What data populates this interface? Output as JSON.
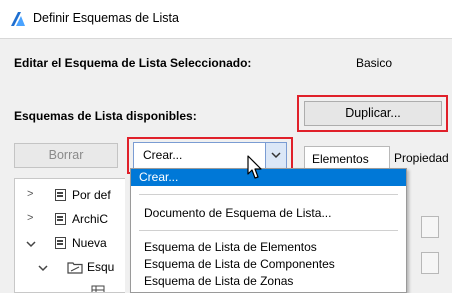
{
  "window": {
    "title": "Definir Esquemas de Lista"
  },
  "header": {
    "edit_label": "Editar el Esquema de Lista Seleccionado:",
    "edit_value": "Basico"
  },
  "schemes": {
    "available_label": "Esquemas de Lista disponibles:",
    "duplicate_button": "Duplicar...",
    "delete_button": "Borrar"
  },
  "combo": {
    "selected": "Crear..."
  },
  "tabs": [
    {
      "label": "Elementos"
    },
    {
      "label": "Propiedad"
    }
  ],
  "tree": {
    "items": [
      {
        "label": "Por def"
      },
      {
        "label": "ArchiC"
      },
      {
        "label": "Nueva"
      },
      {
        "label": "Esqu"
      }
    ]
  },
  "menu": {
    "items": [
      {
        "label": "Crear..."
      },
      {
        "label": "Documento de Esquema de Lista..."
      },
      {
        "label": "Esquema de Lista de Elementos"
      },
      {
        "label": "Esquema de Lista de Componentes"
      },
      {
        "label": "Esquema de Lista de Zonas"
      }
    ]
  },
  "colors": {
    "highlight": "#0078d7",
    "callout": "#e0202a",
    "accent_border": "#7a9cd3"
  }
}
